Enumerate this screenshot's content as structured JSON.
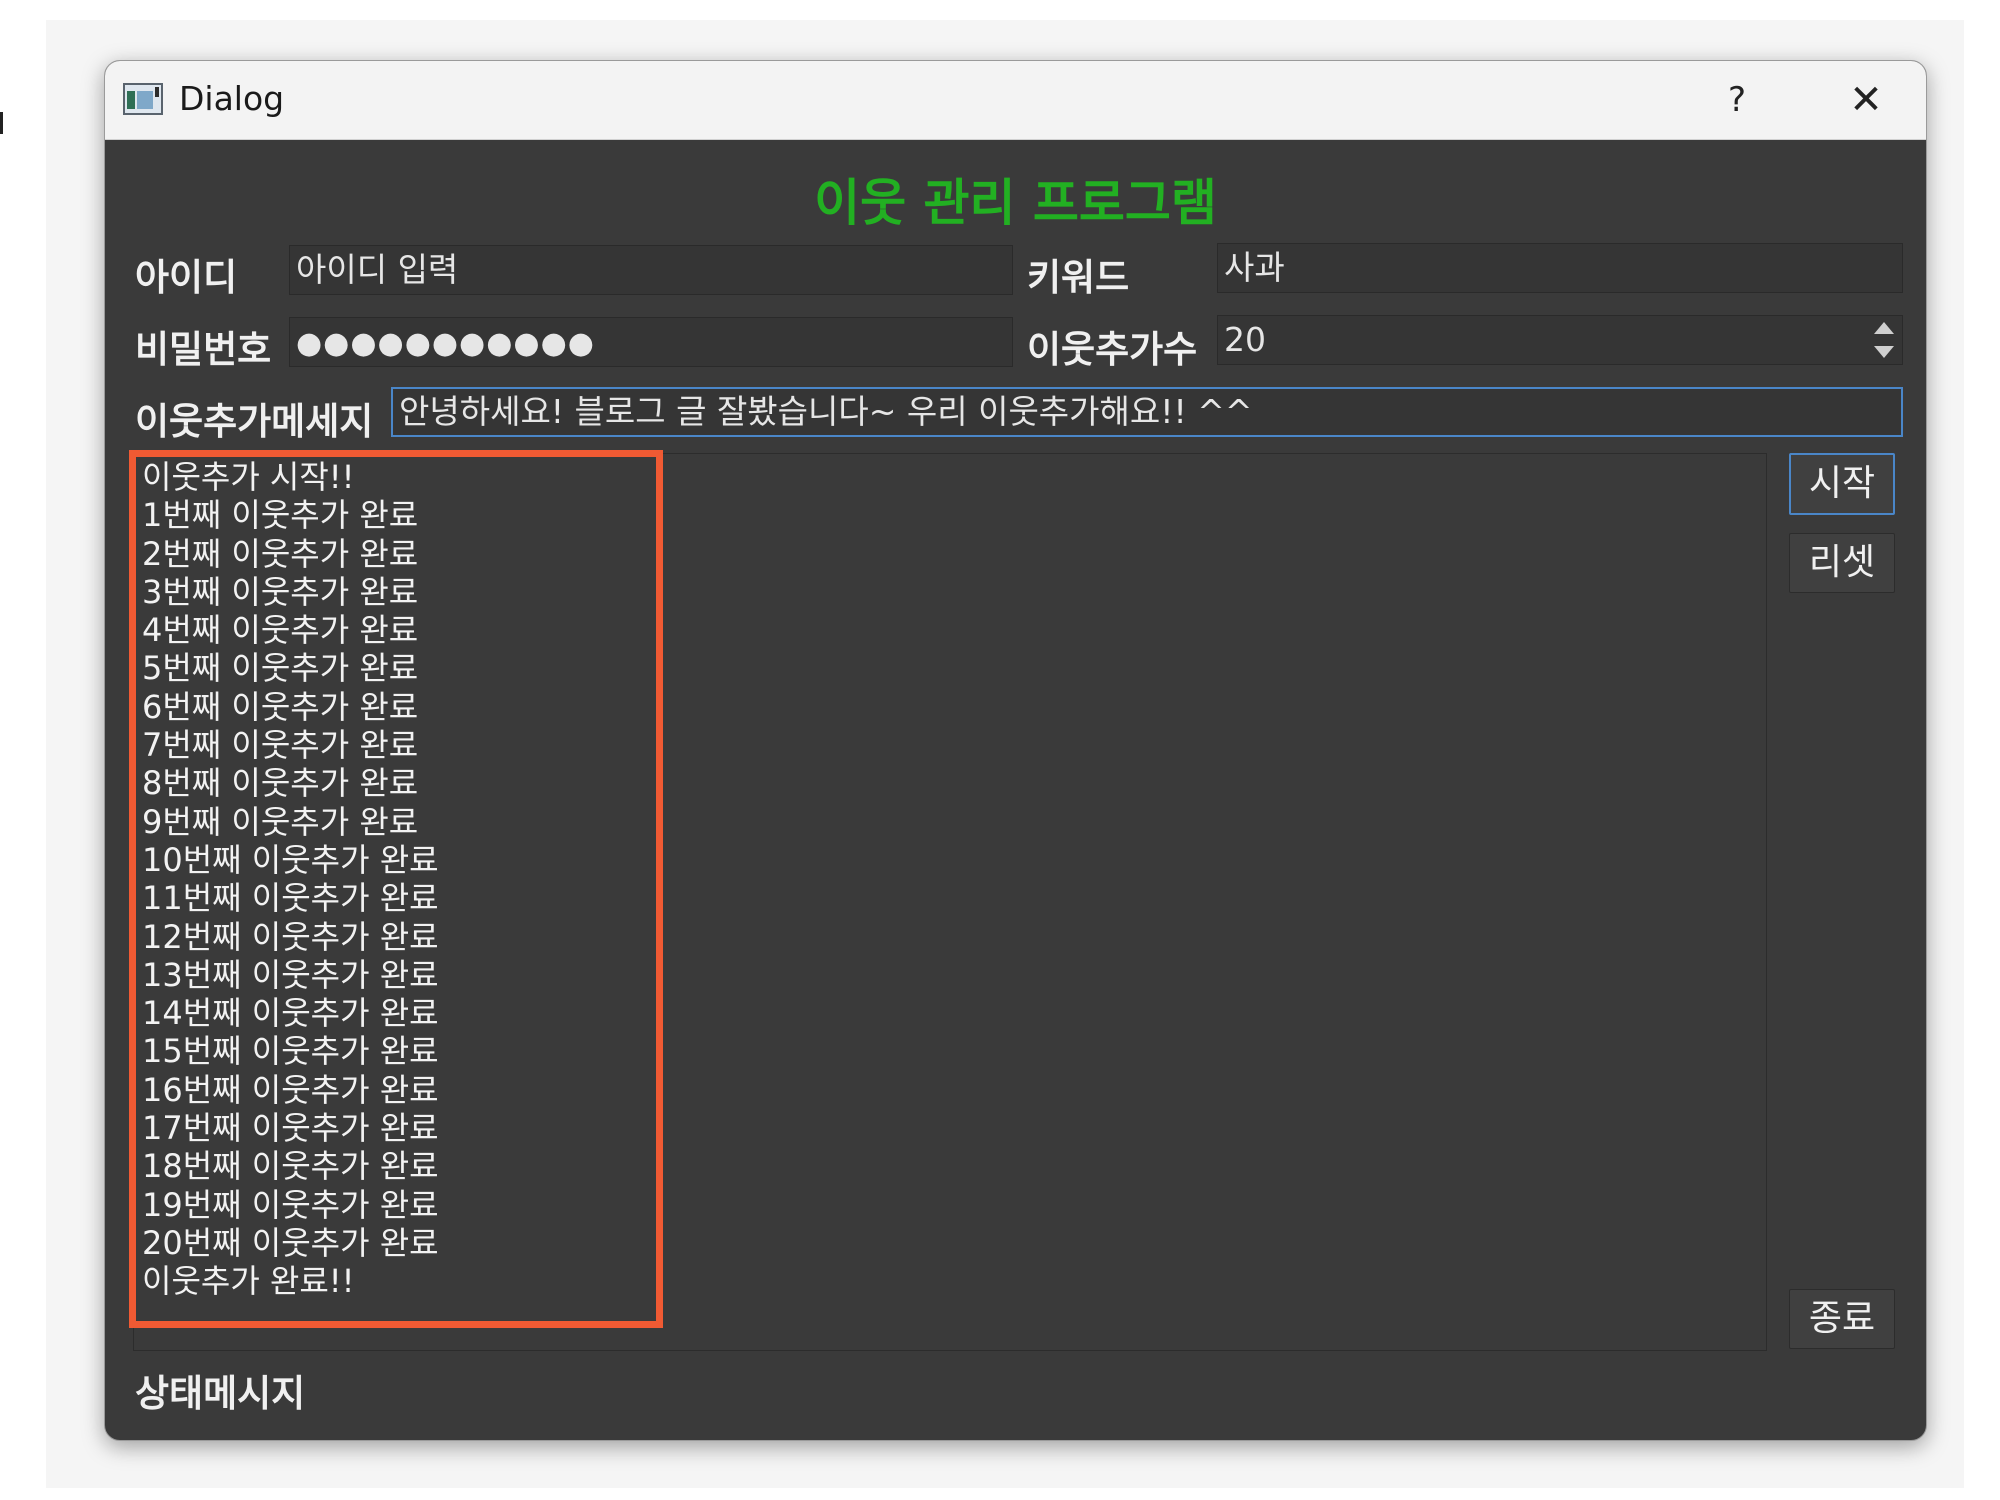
{
  "window": {
    "title": "Dialog",
    "help_label": "?",
    "close_label": "✕"
  },
  "heading": "이웃 관리 프로그램",
  "form": {
    "id_label": "아이디",
    "id_value": "아이디 입력",
    "keyword_label": "키워드",
    "keyword_value": "사과",
    "password_label": "비밀번호",
    "password_mask": "●●●●●●●●●●●",
    "count_label": "이웃추가수",
    "count_value": "20",
    "message_label": "이웃추가메세지",
    "message_value": "안녕하세요! 블로그 글 잘봤습니다~ 우리 이웃추가해요!! ^^"
  },
  "log": [
    "이웃추가 시작!!",
    "1번째 이웃추가 완료",
    "2번째 이웃추가 완료",
    "3번째 이웃추가 완료",
    "4번째 이웃추가 완료",
    "5번째 이웃추가 완료",
    "6번째 이웃추가 완료",
    "7번째 이웃추가 완료",
    "8번째 이웃추가 완료",
    "9번째 이웃추가 완료",
    "10번째 이웃추가 완료",
    "11번째 이웃추가 완료",
    "12번째 이웃추가 완료",
    "13번째 이웃추가 완료",
    "14번째 이웃추가 완료",
    "15번째 이웃추가 완료",
    "16번째 이웃추가 완료",
    "17번째 이웃추가 완료",
    "18번째 이웃추가 완료",
    "19번째 이웃추가 완료",
    "20번째 이웃추가 완료",
    "이웃추가 완료!!"
  ],
  "buttons": {
    "start": "시작",
    "reset": "리셋",
    "exit": "종료"
  },
  "status_label": "상태메시지",
  "colors": {
    "heading": "#22b022",
    "highlight": "#f05a33",
    "window_bg": "#3a3a3a",
    "focus": "#4a86c8"
  }
}
